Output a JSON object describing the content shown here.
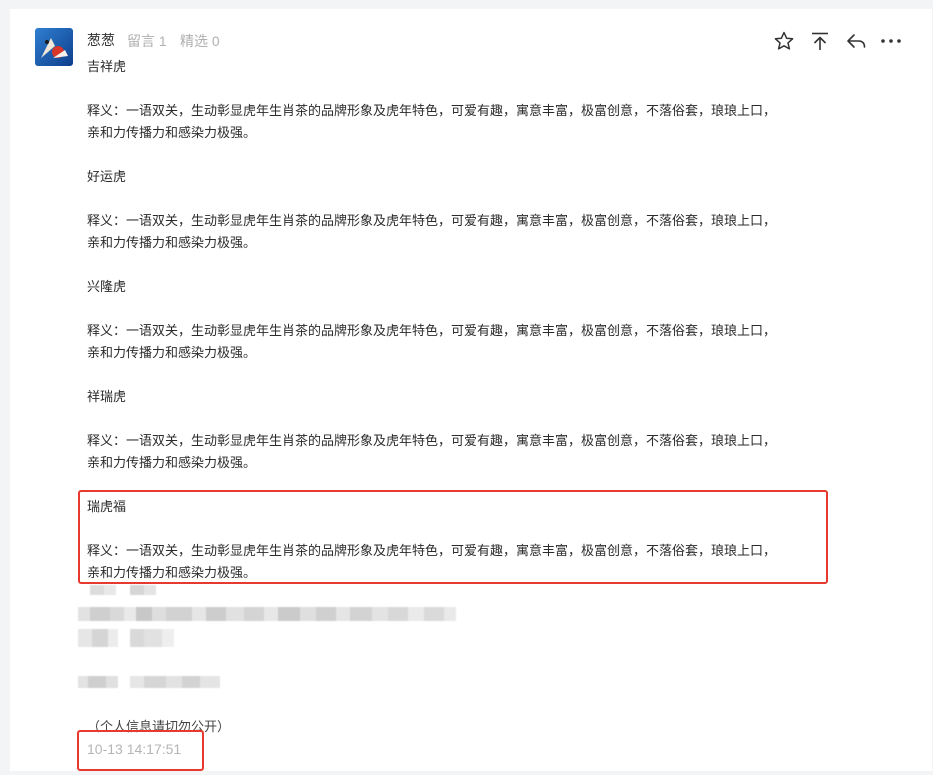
{
  "user": {
    "name": "葱葱",
    "replies": "留言 1",
    "featured": "精选 0"
  },
  "actions": [
    {
      "name": "star-icon"
    },
    {
      "name": "pin-top-icon"
    },
    {
      "name": "reply-icon"
    },
    {
      "name": "more-icon"
    }
  ],
  "post": {
    "blocks": [
      {
        "title": "吉祥虎",
        "desc_line1": "释义：一语双关，生动彰显虎年生肖茶的品牌形象及虎年特色，可爱有趣，寓意丰富，极富创意，不落俗套，琅琅上口，",
        "desc_line2": "亲和力传播力和感染力极强。"
      },
      {
        "title": "好运虎",
        "desc_line1": "释义：一语双关，生动彰显虎年生肖茶的品牌形象及虎年特色，可爱有趣，寓意丰富，极富创意，不落俗套，琅琅上口，",
        "desc_line2": "亲和力传播力和感染力极强。"
      },
      {
        "title": "兴隆虎",
        "desc_line1": "释义：一语双关，生动彰显虎年生肖茶的品牌形象及虎年特色，可爱有趣，寓意丰富，极富创意，不落俗套，琅琅上口，",
        "desc_line2": "亲和力传播力和感染力极强。"
      },
      {
        "title": "祥瑞虎",
        "desc_line1": "释义：一语双关，生动彰显虎年生肖茶的品牌形象及虎年特色，可爱有趣，寓意丰富，极富创意，不落俗套，琅琅上口，",
        "desc_line2": "亲和力传播力和感染力极强。"
      },
      {
        "title": "瑞虎福",
        "desc_line1": "释义：一语双关，生动彰显虎年生肖茶的品牌形象及虎年特色，可爱有趣，寓意丰富，极富创意，不落俗套，琅琅上口，",
        "desc_line2": "亲和力传播力和感染力极强。"
      }
    ],
    "privacy_note": "（个人信息请切勿公开）",
    "timestamp": "10-13 14:17:51"
  },
  "colors": {
    "highlight": "#e8392e",
    "muted": "#b0b0b0"
  }
}
